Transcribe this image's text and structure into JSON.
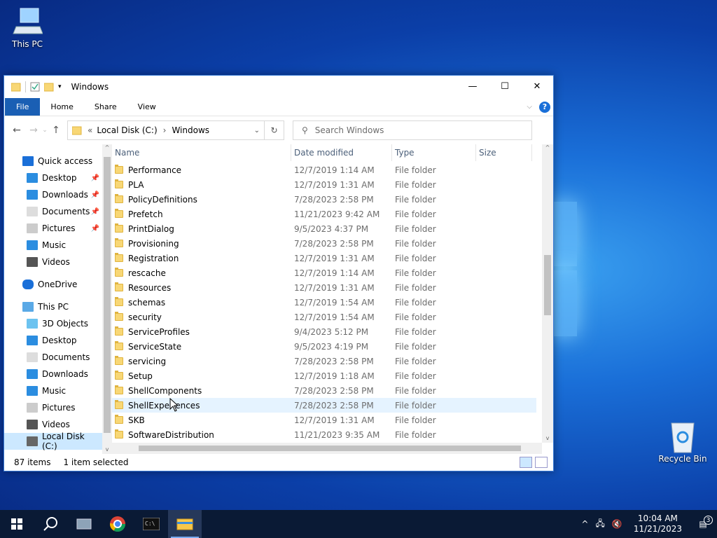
{
  "desktop": {
    "this_pc": "This PC",
    "recycle_bin": "Recycle Bin"
  },
  "window": {
    "title": "Windows",
    "minimize": "—",
    "maximize": "☐",
    "close": "✕"
  },
  "ribbon": {
    "file": "File",
    "home": "Home",
    "share": "Share",
    "view": "View",
    "help": "?"
  },
  "address": {
    "prefix": "«",
    "crumb1": "Local Disk (C:)",
    "sep": "›",
    "crumb2": "Windows",
    "search_placeholder": "Search Windows"
  },
  "nav": [
    {
      "label": "Quick access",
      "indent": 1,
      "icon": "star-icon",
      "pin": false
    },
    {
      "label": "Desktop",
      "indent": 2,
      "icon": "desktop-icon",
      "pin": true
    },
    {
      "label": "Downloads",
      "indent": 2,
      "icon": "download-icon",
      "pin": true
    },
    {
      "label": "Documents",
      "indent": 2,
      "icon": "document-icon",
      "pin": true
    },
    {
      "label": "Pictures",
      "indent": 2,
      "icon": "pictures-icon",
      "pin": true
    },
    {
      "label": "Music",
      "indent": 2,
      "icon": "music-icon",
      "pin": false
    },
    {
      "label": "Videos",
      "indent": 2,
      "icon": "videos-icon",
      "pin": false
    },
    {
      "label": "",
      "indent": 0,
      "icon": "",
      "pin": false
    },
    {
      "label": "OneDrive",
      "indent": 1,
      "icon": "cloud-icon",
      "pin": false
    },
    {
      "label": "",
      "indent": 0,
      "icon": "",
      "pin": false
    },
    {
      "label": "This PC",
      "indent": 1,
      "icon": "pc-icon",
      "pin": false
    },
    {
      "label": "3D Objects",
      "indent": 2,
      "icon": "cube-icon",
      "pin": false
    },
    {
      "label": "Desktop",
      "indent": 2,
      "icon": "desktop-icon",
      "pin": false
    },
    {
      "label": "Documents",
      "indent": 2,
      "icon": "document-icon",
      "pin": false
    },
    {
      "label": "Downloads",
      "indent": 2,
      "icon": "download-icon",
      "pin": false
    },
    {
      "label": "Music",
      "indent": 2,
      "icon": "music-icon",
      "pin": false
    },
    {
      "label": "Pictures",
      "indent": 2,
      "icon": "pictures-icon",
      "pin": false
    },
    {
      "label": "Videos",
      "indent": 2,
      "icon": "videos-icon",
      "pin": false
    },
    {
      "label": "Local Disk (C:)",
      "indent": 2,
      "icon": "drive-icon",
      "pin": false,
      "selected": true
    }
  ],
  "columns": {
    "name": "Name",
    "date": "Date modified",
    "type": "Type",
    "size": "Size"
  },
  "files": [
    {
      "name": "Performance",
      "date": "12/7/2019 1:14 AM",
      "type": "File folder"
    },
    {
      "name": "PLA",
      "date": "12/7/2019 1:31 AM",
      "type": "File folder"
    },
    {
      "name": "PolicyDefinitions",
      "date": "7/28/2023 2:58 PM",
      "type": "File folder"
    },
    {
      "name": "Prefetch",
      "date": "11/21/2023 9:42 AM",
      "type": "File folder"
    },
    {
      "name": "PrintDialog",
      "date": "9/5/2023 4:37 PM",
      "type": "File folder"
    },
    {
      "name": "Provisioning",
      "date": "7/28/2023 2:58 PM",
      "type": "File folder"
    },
    {
      "name": "Registration",
      "date": "12/7/2019 1:31 AM",
      "type": "File folder"
    },
    {
      "name": "rescache",
      "date": "12/7/2019 1:14 AM",
      "type": "File folder"
    },
    {
      "name": "Resources",
      "date": "12/7/2019 1:31 AM",
      "type": "File folder"
    },
    {
      "name": "schemas",
      "date": "12/7/2019 1:54 AM",
      "type": "File folder"
    },
    {
      "name": "security",
      "date": "12/7/2019 1:54 AM",
      "type": "File folder"
    },
    {
      "name": "ServiceProfiles",
      "date": "9/4/2023 5:12 PM",
      "type": "File folder"
    },
    {
      "name": "ServiceState",
      "date": "9/5/2023 4:19 PM",
      "type": "File folder"
    },
    {
      "name": "servicing",
      "date": "7/28/2023 2:58 PM",
      "type": "File folder"
    },
    {
      "name": "Setup",
      "date": "12/7/2019 1:18 AM",
      "type": "File folder"
    },
    {
      "name": "ShellComponents",
      "date": "7/28/2023 2:58 PM",
      "type": "File folder"
    },
    {
      "name": "ShellExperiences",
      "date": "7/28/2023 2:58 PM",
      "type": "File folder",
      "hover": true
    },
    {
      "name": "SKB",
      "date": "12/7/2019 1:31 AM",
      "type": "File folder"
    },
    {
      "name": "SoftwareDistribution",
      "date": "11/21/2023 9:35 AM",
      "type": "File folder"
    }
  ],
  "status": {
    "count": "87 items",
    "selection": "1 item selected"
  },
  "taskbar": {
    "time": "10:04 AM",
    "date": "11/21/2023",
    "notifications": "3"
  }
}
